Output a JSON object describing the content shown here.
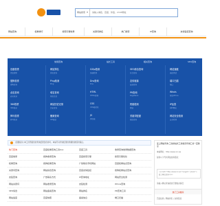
{
  "brand": {
    "accent": "#f29111",
    "panel_blue": "#1852a8",
    "hot_red": "#e03a1e",
    "logo_icon": "site-logo"
  },
  "search": {
    "select_label": "网站搜索",
    "placeholder": "请输入域名、百度、外链、2345网址"
  },
  "nav": {
    "items": [
      "网站查询",
      "权重排行",
      "搜索引擎收录",
      "关键词排名",
      "热门搜索",
      "IP查询",
      "友情链接查询"
    ]
  },
  "panel": {
    "headers": [
      "常用查询",
      "站长工具",
      "相关查询",
      "SEO查询"
    ],
    "columns": [
      [
        {
          "label": "百度权重",
          "sub": "百度搜索"
        },
        {
          "label": "搜狗权重",
          "sub": "搜狗查询"
        },
        {
          "label": "必应查询",
          "sub": "必应收录"
        },
        {
          "label": "360权重",
          "sub": "360收录"
        },
        {
          "label": "神马权重",
          "sub": "神马收录"
        }
      ],
      [
        {
          "label": "网站排名",
          "sub": "排名查询"
        },
        {
          "label": "Ping检测",
          "sub": "Ping"
        },
        {
          "label": "域名查询",
          "sub": "域名信息"
        },
        {
          "label": "网站历史记录",
          "sub": "历史查询"
        },
        {
          "label": "备案查询",
          "sub": "ICP备案"
        }
      ],
      [
        {
          "label": "GZip检测",
          "sub": "压缩检测"
        },
        {
          "label": "Dns查询",
          "sub": "Dns"
        },
        {
          "label": "HTML",
          "sub": "HTML转换"
        },
        {
          "label": "CSS",
          "sub": "CSS格式化"
        },
        {
          "label": "JS",
          "sub": "JS压缩"
        }
      ],
      [
        {
          "label": "SEO综合查询",
          "sub": "综合查询"
        },
        {
          "label": "友情链接",
          "sub": "友链查询"
        },
        {
          "label": "PR查询",
          "sub": "PageRank"
        },
        {
          "label": "死链检测",
          "sub": "死链"
        },
        {
          "label": "关键词密度",
          "sub": "密度查询"
        }
      ],
      [
        {
          "label": "网站速度",
          "sub": "速度测试"
        },
        {
          "label": "端口扫描",
          "sub": "端口"
        },
        {
          "label": "Whois",
          "sub": "域名Whois"
        },
        {
          "label": "IP反查",
          "sub": "同IP网站"
        },
        {
          "label": "网站安全检测",
          "sub": "安全检测"
        }
      ]
    ]
  },
  "tip": {
    "text": "[温馨提示] 本工具所提供的查询结果仅供参考，本站不对查询结果的准确性做任何保证。"
  },
  "links": [
    [
      "热门查询",
      "百度权重查询工具box",
      "百度工具",
      "收录查询收录数据查询"
    ],
    [
      "百度收录",
      "搜狗收录查询",
      "百度搜索引擎",
      "搜索引擎优化"
    ],
    [
      "权重查询",
      "搜狗权重查询",
      "广告联系手机网站",
      "百度权重站点查询"
    ],
    [
      "关键词查询",
      "网站综合查询",
      "百度友情链接",
      "搜狗权重站点查询"
    ],
    [
      "友链查询",
      "广告联系方式",
      "IP查询地址",
      "网站安全检测"
    ],
    [
      "网站关键词",
      "网站收录查询",
      "友链检测",
      "Whois查询"
    ],
    [
      "SEO综合",
      "网站备案查询",
      "网站排名",
      "PR查询工具"
    ],
    [
      "网站速度",
      "百度快照",
      "备案信息",
      "端口扫描"
    ]
  ],
  "side": {
    "title": "爱上网站查询-工具的站长工具收录查询工具一应俱全",
    "line1": "本站网址：http://www.ini.ws",
    "line2": "复制以下代码添加友情链接：",
    "code": "<a href=\"http://www.ini.ws\" target=\"_blank\">爱上网站查询</a>",
    "line3": "请输入网址查询搜索引擎收录情况",
    "box_title": "热门工具推荐",
    "line4": "百度权重 | 网站排名 | 友情链接"
  }
}
